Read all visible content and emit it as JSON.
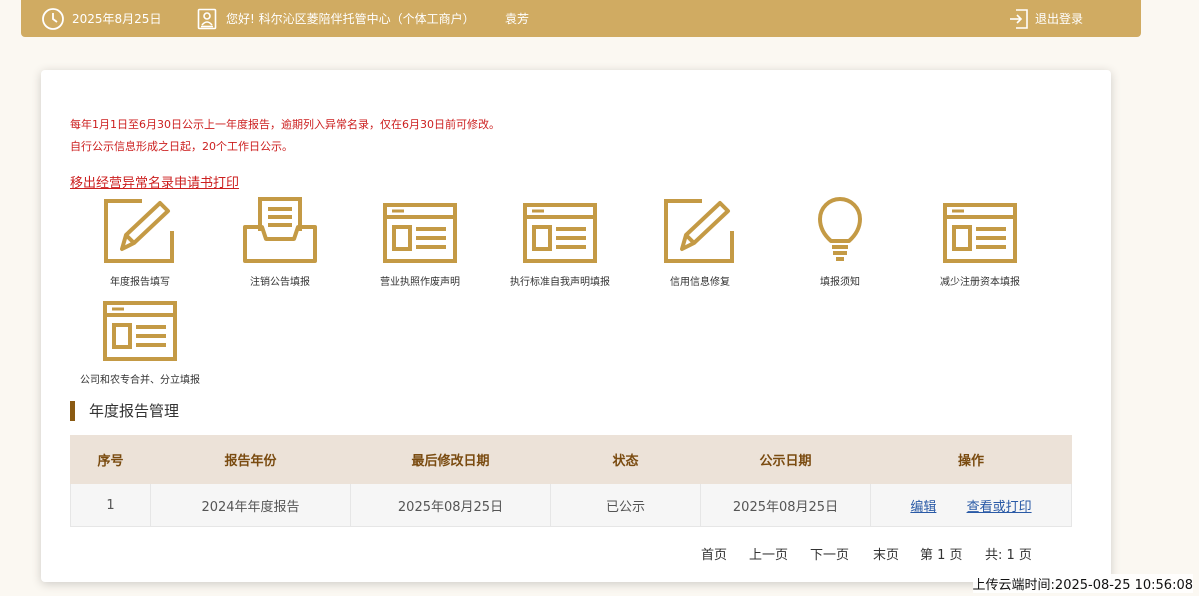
{
  "header": {
    "date": "2025年8月25日",
    "greeting": "您好! 科尔沁区菱陪伴托管中心（个体工商户）",
    "user": "袁芳",
    "logout_label": "退出登录"
  },
  "notices": [
    "每年1月1日至6月30日公示上一年度报告，逾期列入异常名录，仅在6月30日前可修改。",
    "自行公示信息形成之日起，20个工作日公示。"
  ],
  "print_link": "移出经营异常名录申请书打印",
  "tiles": [
    {
      "label": "年度报告填写",
      "icon": "pencil-edit-icon"
    },
    {
      "label": "注销公告填报",
      "icon": "document-tray-icon"
    },
    {
      "label": "营业执照作废声明",
      "icon": "form-window-icon"
    },
    {
      "label": "执行标准自我声明填报",
      "icon": "form-window-icon"
    },
    {
      "label": "信用信息修复",
      "icon": "pencil-edit-icon"
    },
    {
      "label": "填报须知",
      "icon": "lightbulb-icon"
    },
    {
      "label": "减少注册资本填报",
      "icon": "form-window-icon"
    },
    {
      "label": "公司和农专合并、分立填报",
      "icon": "form-window-icon"
    }
  ],
  "section_title": "年度报告管理",
  "table": {
    "headers": [
      "序号",
      "报告年份",
      "最后修改日期",
      "状态",
      "公示日期",
      "操作"
    ],
    "rows": [
      {
        "index": "1",
        "year": "2024年年度报告",
        "modified": "2025年08月25日",
        "status": "已公示",
        "public_date": "2025年08月25日",
        "edit": "编辑",
        "view": "查看或打印"
      }
    ]
  },
  "pager": {
    "first": "首页",
    "prev": "上一页",
    "next": "下一页",
    "last": "末页",
    "current": "第 1 页",
    "total": "共:  1 页"
  },
  "watermark": "上传云端时间:2025-08-25 10:56:08",
  "colors": {
    "accent": "#d0ab62",
    "icon_gold": "#c49a45",
    "alert_red": "#cc1f1f",
    "link_blue": "#2a5aa6",
    "header_brown": "#7a4b10"
  }
}
